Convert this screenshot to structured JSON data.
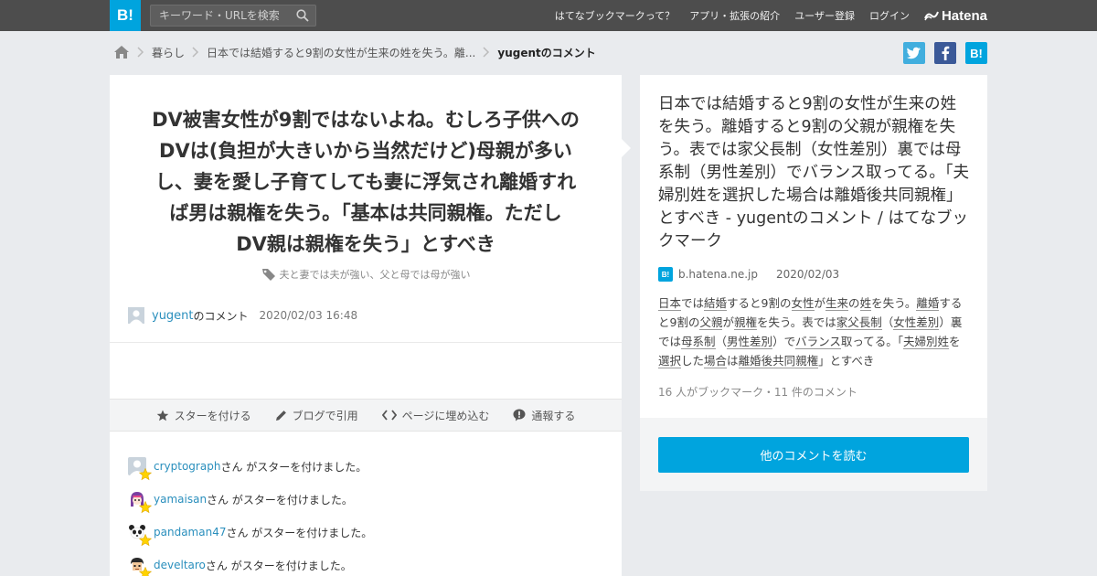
{
  "header": {
    "logo": "B!",
    "search_placeholder": "キーワード・URLを検索",
    "nav": [
      "はてなブックマークって？",
      "アプリ・拡張の紹介",
      "ユーザー登録",
      "ログイン"
    ],
    "brand": "Hatena",
    "accent": "#00a4de"
  },
  "breadcrumb": {
    "items": [
      "暮らし",
      "日本では結婚すると9割の女性が生来の姓を失う。離..."
    ],
    "current": "yugentのコメント"
  },
  "share": {
    "twitter": {
      "icon": "twitter-icon",
      "color": "#41aede"
    },
    "facebook": {
      "icon": "facebook-icon",
      "color": "#3b5998"
    },
    "hatena": {
      "label": "B!",
      "color": "#00a4de"
    }
  },
  "comment": {
    "lines": [
      "DV被害女性が9割ではないよね。むしろ子供への",
      "DVは(負担が大きいから当然だけど)母親が多い",
      "し、妻を愛し子育てしても妻に浮気され離婚すれ",
      "ば男は親権を失う。「基本は共同親権。ただし",
      "DV親は親権を失う」とすべき"
    ],
    "tags": "夫と妻では夫が強い、父と母では母が強い",
    "user": "yugent",
    "user_suffix": "のコメント",
    "date": "2020/02/03 16:48"
  },
  "actions": [
    {
      "icon": "star-icon",
      "label": "スターを付ける"
    },
    {
      "icon": "pencil-icon",
      "label": "ブログで引用"
    },
    {
      "icon": "code-icon",
      "label": "ページに埋め込む"
    },
    {
      "icon": "report-icon",
      "label": "通報する"
    }
  ],
  "stars": {
    "suffix": "さん がスターを付けました。",
    "users": [
      "cryptograph",
      "yamaisan",
      "pandaman47",
      "develtaro"
    ]
  },
  "entry": {
    "title": "日本では結婚すると9割の女性が生来の姓を失う。離婚すると9割の父親が親権を失う。表では家父長制（女性差別）裏では母系制（男性差別）でバランス取ってる。「夫婦別姓を選択した場合は離婚後共同親権」とすべき - yugentのコメント / はてなブックマーク",
    "source": "b.hatena.ne.jp",
    "source_icon": "B!",
    "date": "2020/02/03",
    "desc": [
      {
        "t": "日本",
        "k": true
      },
      {
        "t": "では",
        "k": false
      },
      {
        "t": "結婚",
        "k": true
      },
      {
        "t": "すると9割の",
        "k": false
      },
      {
        "t": "女性",
        "k": true
      },
      {
        "t": "が",
        "k": false
      },
      {
        "t": "生来",
        "k": true
      },
      {
        "t": "の",
        "k": false
      },
      {
        "t": "姓",
        "k": true
      },
      {
        "t": "を失う。",
        "k": false
      },
      {
        "t": "離婚",
        "k": true
      },
      {
        "t": "すると9割の",
        "k": false
      },
      {
        "t": "父親",
        "k": true
      },
      {
        "t": "が",
        "k": false
      },
      {
        "t": "親権",
        "k": true
      },
      {
        "t": "を失う。表では",
        "k": false
      },
      {
        "t": "家父長制",
        "k": true
      },
      {
        "t": "（",
        "k": false
      },
      {
        "t": "女性差別",
        "k": true
      },
      {
        "t": "）裏では",
        "k": false
      },
      {
        "t": "母系制",
        "k": true
      },
      {
        "t": "（",
        "k": false
      },
      {
        "t": "男性差別",
        "k": true
      },
      {
        "t": "）で",
        "k": false
      },
      {
        "t": "バランス",
        "k": true
      },
      {
        "t": "取ってる。「",
        "k": false
      },
      {
        "t": "夫婦別姓",
        "k": true
      },
      {
        "t": "を",
        "k": false
      },
      {
        "t": "選択",
        "k": true
      },
      {
        "t": "した",
        "k": false
      },
      {
        "t": "場合",
        "k": true
      },
      {
        "t": "は",
        "k": false
      },
      {
        "t": "離婚後",
        "k": true
      },
      {
        "t": "共同親権",
        "k": true
      },
      {
        "t": "」とすべき",
        "k": false
      }
    ],
    "count": "16 人がブックマーク・11 件のコメント",
    "read_more": "他のコメントを読む"
  }
}
